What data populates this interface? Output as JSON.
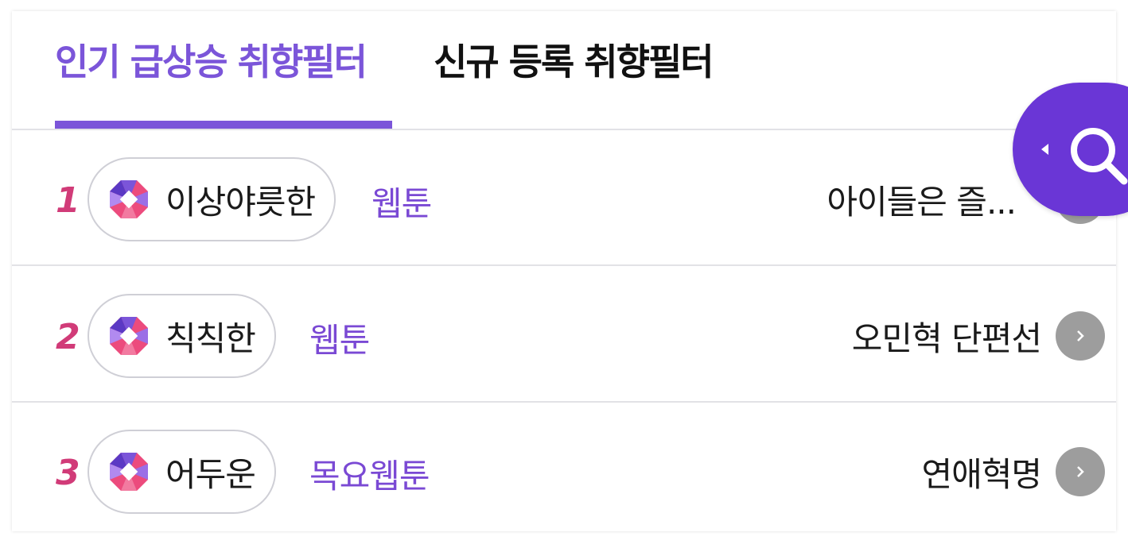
{
  "tabs": [
    {
      "label": "인기 급상승 취향필터",
      "active": true
    },
    {
      "label": "신규 등록 취향필터",
      "active": false
    }
  ],
  "rows": [
    {
      "rank": "1",
      "tag": "이상야릇한",
      "genre": "웹툰",
      "title": "아이들은 즐..."
    },
    {
      "rank": "2",
      "tag": "칙칙한",
      "genre": "웹툰",
      "title": "오민혁 단편선"
    },
    {
      "rank": "3",
      "tag": "어두운",
      "genre": "목요웹툰",
      "title": "연애혁명"
    }
  ],
  "icons": {
    "logo": "octagon-logo-icon",
    "go": "chevron-right-icon",
    "fab": "search-icon",
    "fab_arrow": "caret-left-icon"
  },
  "colors": {
    "accent": "#7b55d9",
    "rank": "#d13b78",
    "genre": "#7a49d4",
    "fab": "#6a36d6",
    "go_button": "#9d9d9d"
  }
}
